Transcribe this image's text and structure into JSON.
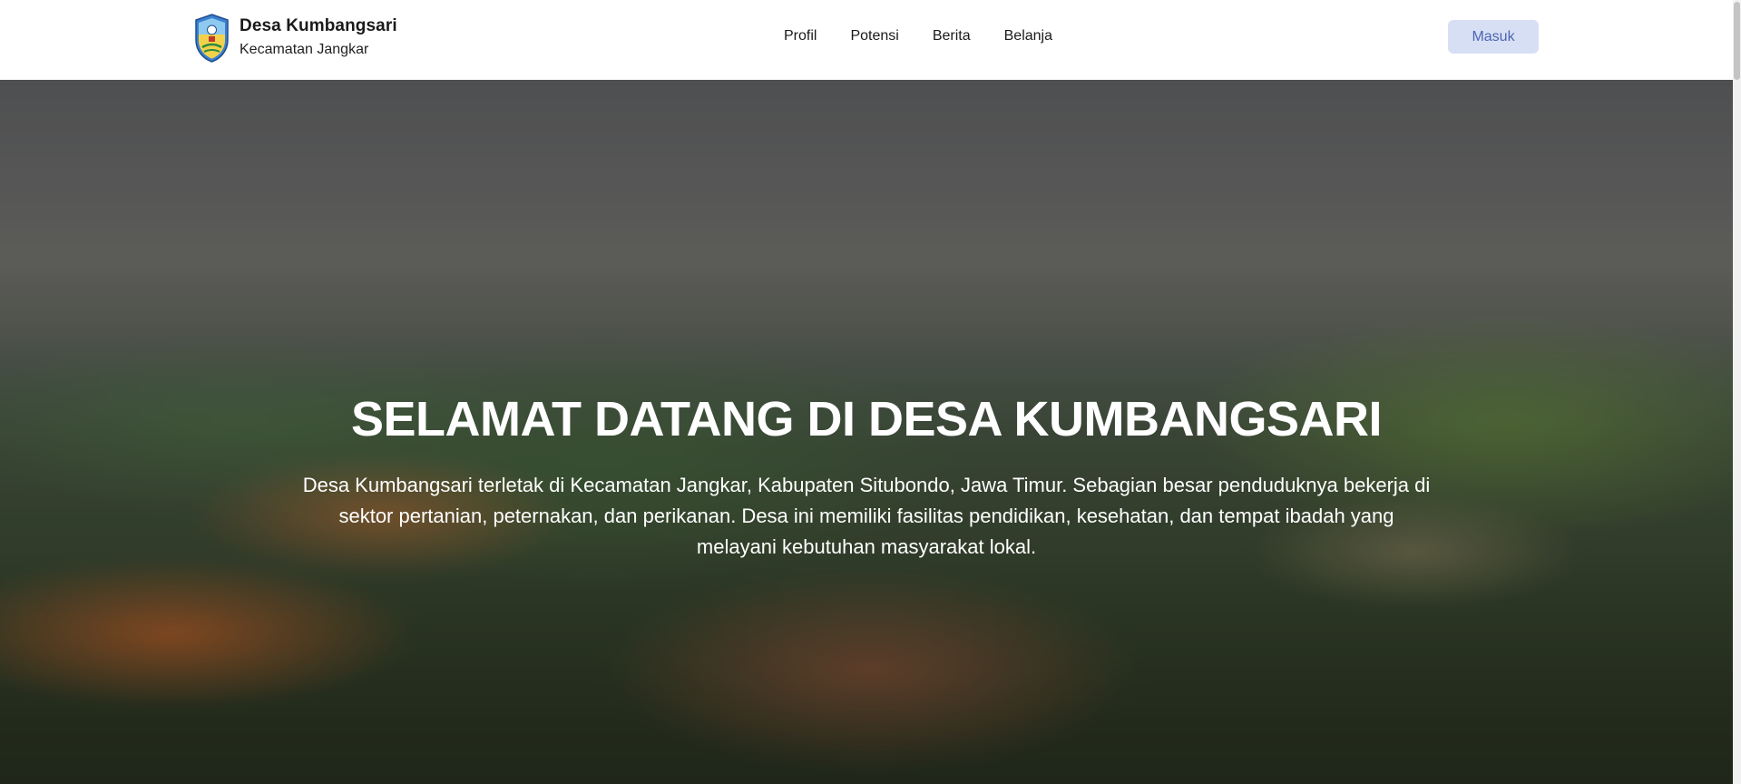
{
  "header": {
    "brand_title": "Desa Kumbangsari",
    "brand_subtitle": "Kecamatan Jangkar",
    "logo_icon": "village-crest-icon",
    "nav": [
      {
        "label": "Profil"
      },
      {
        "label": "Potensi"
      },
      {
        "label": "Berita"
      },
      {
        "label": "Belanja"
      }
    ],
    "login_label": "Masuk"
  },
  "hero": {
    "title": "SELAMAT DATANG DI DESA KUMBANGSARI",
    "description": "Desa Kumbangsari terletak di Kecamatan Jangkar, Kabupaten Situbondo, Jawa Timur. Sebagian besar penduduknya bekerja di sektor pertanian, peternakan, dan perikanan. Desa ini memiliki fasilitas pendidikan, kesehatan, dan tempat ibadah yang melayani kebutuhan masyarakat lokal."
  },
  "colors": {
    "login_bg": "#d7dff4",
    "login_text": "#4c66b3",
    "hero_text": "#ffffff"
  }
}
